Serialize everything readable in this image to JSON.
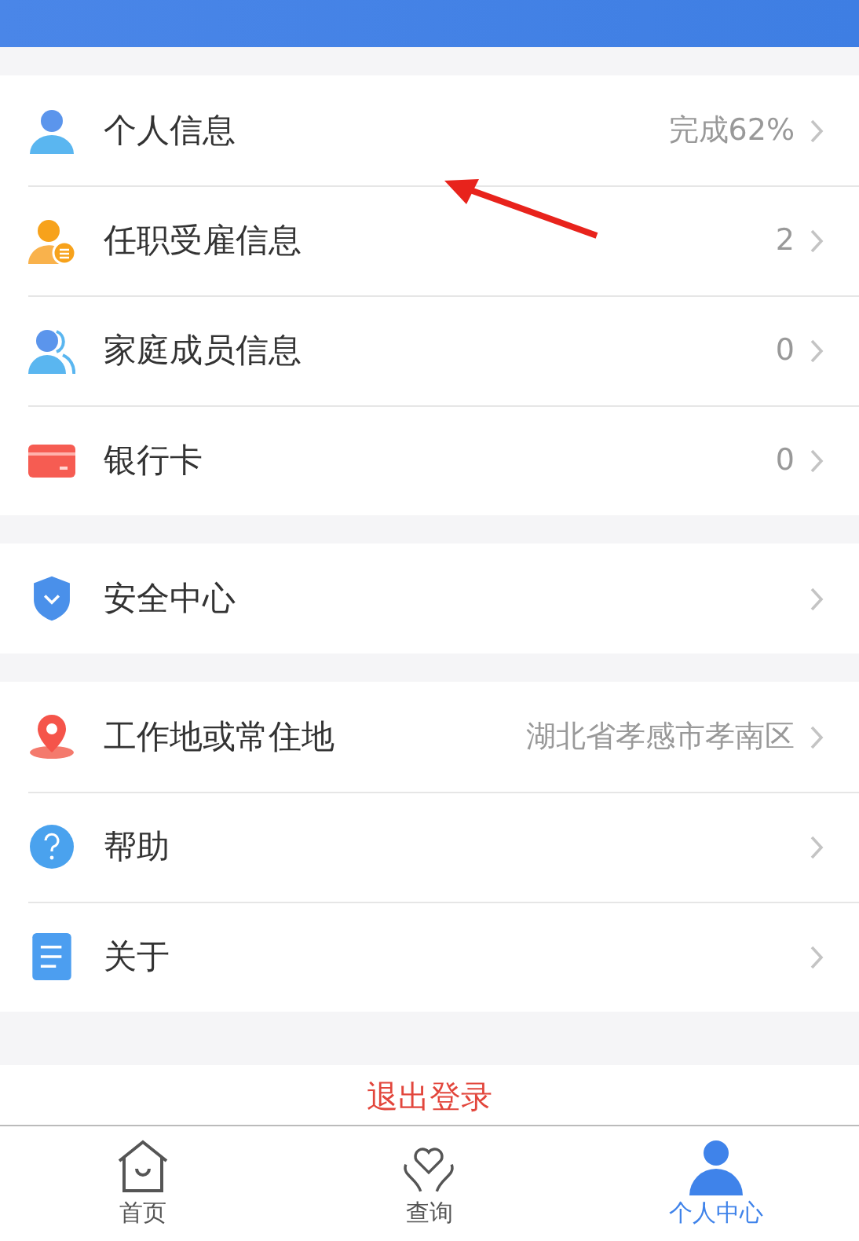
{
  "groups": [
    {
      "items": [
        {
          "label": "个人信息",
          "value": "完成62%"
        },
        {
          "label": "任职受雇信息",
          "value": "2"
        },
        {
          "label": "家庭成员信息",
          "value": "0"
        },
        {
          "label": "银行卡",
          "value": "0"
        }
      ]
    },
    {
      "items": [
        {
          "label": "安全中心"
        }
      ]
    },
    {
      "items": [
        {
          "label": "工作地或常住地",
          "value": "湖北省孝感市孝南区"
        },
        {
          "label": "帮助"
        },
        {
          "label": "关于"
        }
      ]
    }
  ],
  "logout": "退出登录",
  "tabs": [
    {
      "label": "首页",
      "selected": false
    },
    {
      "label": "查询",
      "selected": false
    },
    {
      "label": "个人中心",
      "selected": true
    }
  ]
}
